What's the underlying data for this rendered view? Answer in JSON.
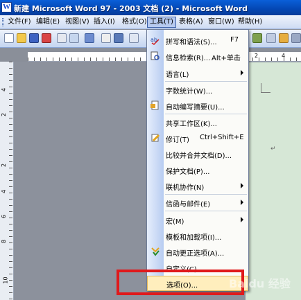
{
  "window": {
    "title": "新建 Microsoft Word 97 - 2003 文档 (2) - Microsoft Word"
  },
  "menubar": {
    "items": [
      {
        "label": "文件(F)"
      },
      {
        "label": "编辑(E)"
      },
      {
        "label": "视图(V)"
      },
      {
        "label": "插入(I)"
      },
      {
        "label": "格式(O)"
      },
      {
        "label": "工具(T)",
        "active": true
      },
      {
        "label": "表格(A)"
      },
      {
        "label": "窗口(W)"
      },
      {
        "label": "帮助(H)"
      }
    ]
  },
  "ruler": {
    "h_numbers": [
      "2",
      "4"
    ],
    "v_numbers": [
      "4",
      "2",
      "2",
      "4",
      "6",
      "8",
      "10"
    ]
  },
  "page": {
    "paragraph_mark": "↵"
  },
  "tools_menu": {
    "items": [
      {
        "label": "拼写和语法(S)...",
        "shortcut": "F7",
        "icon": "spelling-icon"
      },
      {
        "label": "信息检索(R)...",
        "shortcut": "Alt+单击",
        "icon": "research-icon"
      },
      {
        "label": "语言(L)",
        "submenu": true
      },
      {
        "label": "字数统计(W)..."
      },
      {
        "label": "自动编写摘要(U)...",
        "icon": "autosummarize-icon"
      },
      {
        "label": "共享工作区(K)..."
      },
      {
        "label": "修订(T)",
        "shortcut": "Ctrl+Shift+E",
        "icon": "track-changes-icon"
      },
      {
        "label": "比较并合并文档(D)..."
      },
      {
        "label": "保护文档(P)..."
      },
      {
        "label": "联机协作(N)",
        "submenu": true
      },
      {
        "label": "信函与邮件(E)",
        "submenu": true
      },
      {
        "label": "宏(M)",
        "submenu": true
      },
      {
        "label": "模板和加载项(I)..."
      },
      {
        "label": "自动更正选项(A)...",
        "icon": "autocorrect-icon"
      },
      {
        "label": "自定义(C)..."
      },
      {
        "label": "选项(O)...",
        "highlighted": true
      }
    ]
  },
  "watermark": {
    "text": "Baidu 经验"
  }
}
